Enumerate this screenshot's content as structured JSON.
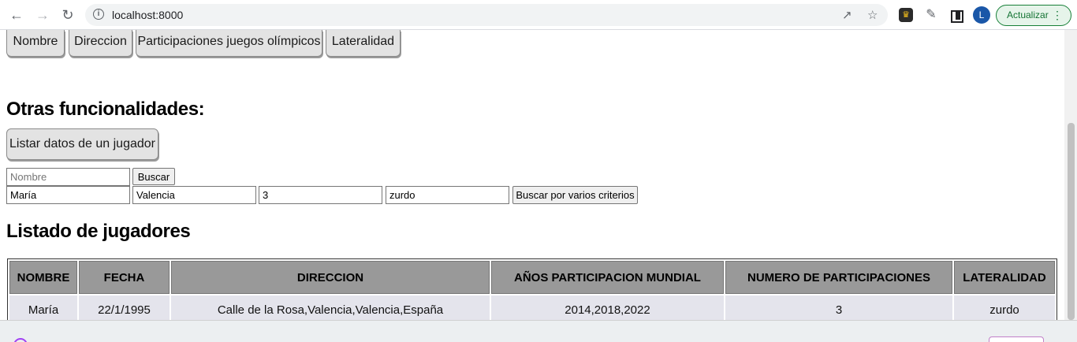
{
  "browser": {
    "url": "localhost:8000",
    "avatar_letter": "L",
    "update_label": "Actualizar"
  },
  "sort_buttons": [
    {
      "label": "Nombre"
    },
    {
      "label": "Direccion"
    },
    {
      "label": "Participaciones juegos olímpicos"
    },
    {
      "label": "Lateralidad"
    }
  ],
  "other": {
    "heading": "Otras funcionalidades:",
    "list_button": "Listar datos de un jugador"
  },
  "search": {
    "name_placeholder": "Nombre",
    "search_button": "Buscar",
    "multi": {
      "name_value": "María",
      "city_value": "Valencia",
      "count_value": "3",
      "laterality_value": "zurdo",
      "button": "Buscar por varios criterios"
    }
  },
  "listing": {
    "heading": "Listado de jugadores",
    "columns": [
      "NOMBRE",
      "FECHA",
      "DIRECCION",
      "AÑOS PARTICIPACION MUNDIAL",
      "NUMERO DE PARTICIPACIONES",
      "LATERALIDAD"
    ],
    "rows": [
      [
        "María",
        "22/1/1995",
        "Calle de la Rosa,Valencia,Valencia,España",
        "2014,2018,2022",
        "3",
        "zurdo"
      ]
    ]
  },
  "colors": {
    "header_bg": "#999999",
    "row_bg": "#e4e4ec",
    "update_green": "#137333",
    "avatar_blue": "#1a57a8"
  }
}
